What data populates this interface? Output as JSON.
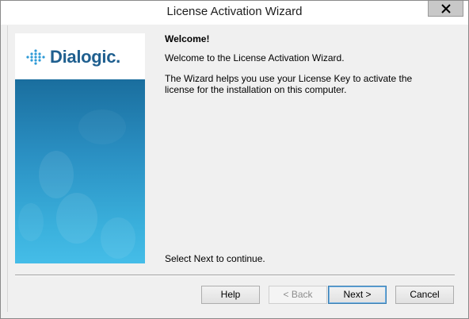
{
  "window": {
    "title": "License Activation Wizard"
  },
  "branding": {
    "logo_text": "Dialogic."
  },
  "page": {
    "heading": "Welcome!",
    "intro": "Welcome to the License Activation Wizard.",
    "description": "The Wizard helps you use your License Key to activate the license for the installation on this computer.",
    "continue_prompt": "Select Next to continue."
  },
  "buttons": {
    "help": "Help",
    "back": "< Back",
    "next": "Next >",
    "cancel": "Cancel",
    "back_enabled": false,
    "default": "next"
  },
  "colors": {
    "brand_text": "#1f5f8f",
    "panel_gradient_top": "#1a6e9e",
    "panel_gradient_bottom": "#45bde8",
    "close_button": "#c8c8c8"
  }
}
